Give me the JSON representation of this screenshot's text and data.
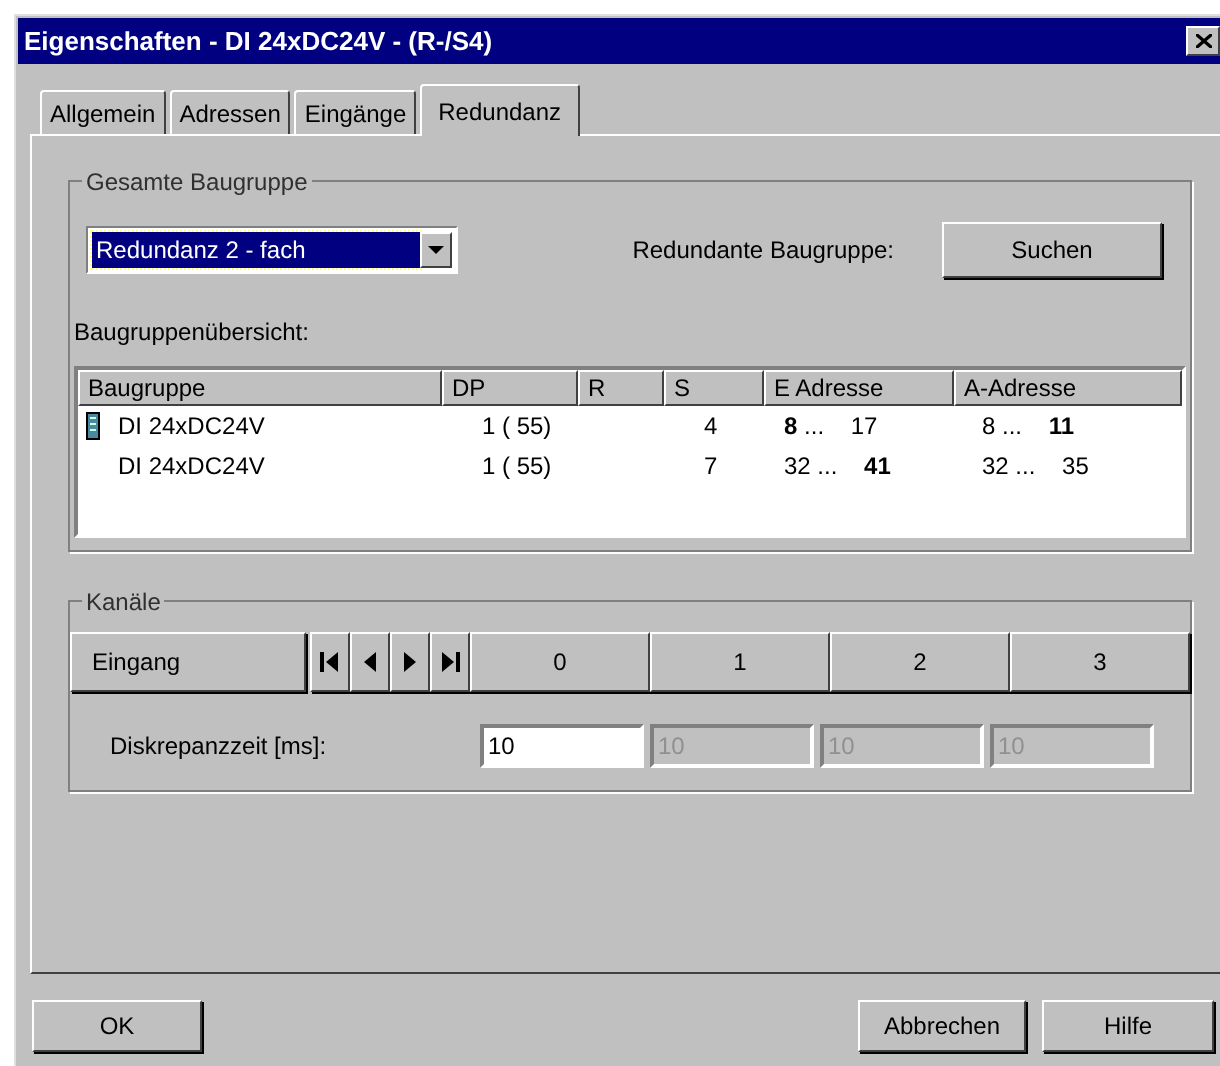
{
  "window": {
    "title": "Eigenschaften - DI 24xDC24V - (R-/S4)"
  },
  "tabs": [
    {
      "label": "Allgemein",
      "selected": false
    },
    {
      "label": "Adressen",
      "selected": false
    },
    {
      "label": "Eingänge",
      "selected": false
    },
    {
      "label": "Redundanz",
      "selected": true
    }
  ],
  "group_module": {
    "legend": "Gesamte Baugruppe",
    "dropdown": {
      "value": "Redundanz 2 - fach",
      "focused": true
    },
    "redundant_label": "Redundante Baugruppe:",
    "search_button": "Suchen",
    "overview_label": "Baugruppenübersicht:"
  },
  "table": {
    "columns": [
      "Baugruppe",
      "DP",
      "R",
      "S",
      "E Adresse",
      "A-Adresse"
    ],
    "rows": [
      {
        "marked": true,
        "cells": [
          "DI 24xDC24V",
          "1 ( 55)",
          "",
          "4",
          "**8** ...    17",
          "8 ...    **11**"
        ]
      },
      {
        "marked": false,
        "cells": [
          "DI 24xDC24V",
          "1 ( 55)",
          "",
          "7",
          "32 ...    **41**",
          "32 ...    35"
        ]
      }
    ]
  },
  "group_channels": {
    "legend": "Kanäle",
    "header_button": "Eingang",
    "channels": [
      "0",
      "1",
      "2",
      "3"
    ],
    "field_label": "Diskrepanzzeit [ms]:",
    "fields": [
      {
        "value": "10",
        "disabled": false
      },
      {
        "value": "10",
        "disabled": true
      },
      {
        "value": "10",
        "disabled": true
      },
      {
        "value": "10",
        "disabled": true
      }
    ]
  },
  "buttons": {
    "ok": "OK",
    "cancel": "Abbrechen",
    "help": "Hilfe"
  }
}
